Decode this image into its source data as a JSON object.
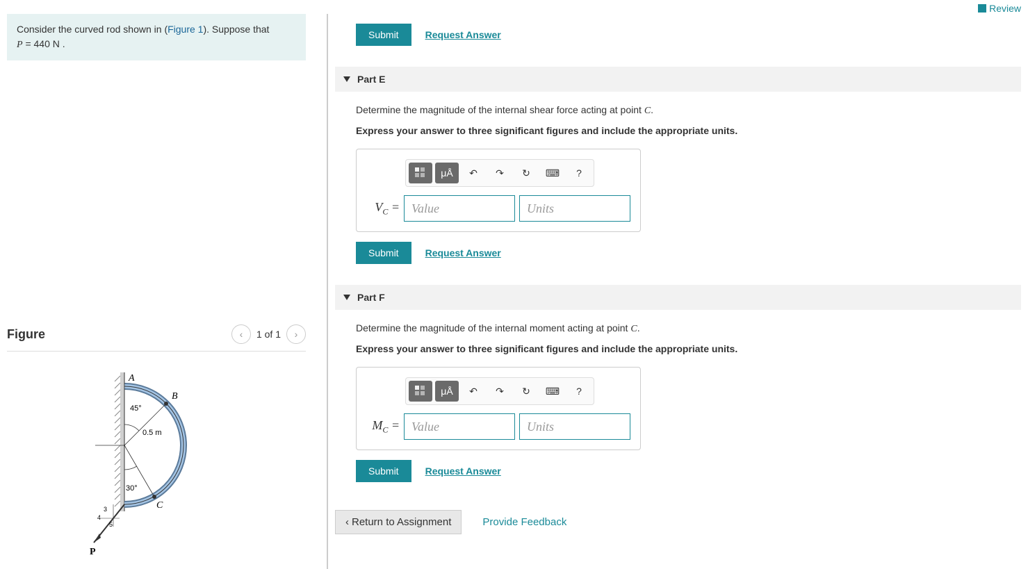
{
  "header": {
    "review": "Review"
  },
  "problem": {
    "text1": "Consider the curved rod shown in (",
    "figlink": "Figure 1",
    "text2": "). Suppose that ",
    "pvar": "P",
    "equals": " = 440  N ."
  },
  "figure": {
    "title": "Figure",
    "counter": "1 of 1",
    "labels": {
      "A": "A",
      "B": "B",
      "C": "C",
      "P": "P",
      "ang1": "45°",
      "ang2": "30°",
      "radius": "0.5 m",
      "n3": "3",
      "n4": "4",
      "n5": "5"
    }
  },
  "top": {
    "submit": "Submit",
    "request": "Request Answer"
  },
  "partE": {
    "label": "Part E",
    "prompt1": "Determine the magnitude of the internal shear force acting at point ",
    "promptVar": "C",
    "prompt2": ".",
    "instruct": "Express your answer to three significant figures and include the appropriate units.",
    "var": "V",
    "sub": "C",
    "eq": " =",
    "valuePh": "Value",
    "unitsPh": "Units",
    "submit": "Submit",
    "request": "Request Answer",
    "muA": "μÅ",
    "q": "?"
  },
  "partF": {
    "label": "Part F",
    "prompt1": "Determine the magnitude of the internal moment acting at point ",
    "promptVar": "C",
    "prompt2": ".",
    "instruct": "Express your answer to three significant figures and include the appropriate units.",
    "var": "M",
    "sub": "C",
    "eq": " =",
    "valuePh": "Value",
    "unitsPh": "Units",
    "submit": "Submit",
    "request": "Request Answer",
    "muA": "μÅ",
    "q": "?"
  },
  "footer": {
    "return": "Return to Assignment",
    "feedback": "Provide Feedback"
  }
}
